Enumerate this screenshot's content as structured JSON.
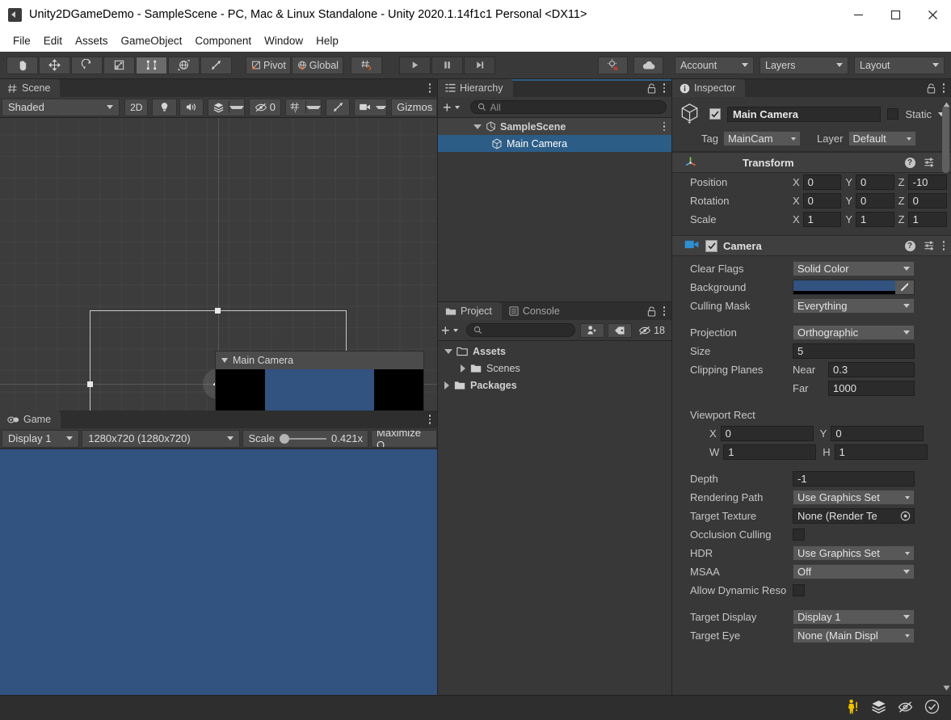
{
  "window": {
    "title": "Unity2DGameDemo - SampleScene - PC, Mac & Linux Standalone - Unity 2020.1.14f1c1 Personal <DX11>",
    "app_icon": "unity-logo-icon",
    "minimize": "minimize-icon",
    "maximize": "maximize-icon",
    "close": "close-icon"
  },
  "menubar": {
    "items": [
      "File",
      "Edit",
      "Assets",
      "GameObject",
      "Component",
      "Window",
      "Help"
    ]
  },
  "toolbar": {
    "tools": [
      {
        "name": "hand-tool",
        "active": false
      },
      {
        "name": "move-tool",
        "active": false
      },
      {
        "name": "rotate-tool",
        "active": false
      },
      {
        "name": "scale-tool",
        "active": false
      },
      {
        "name": "rect-tool",
        "active": true
      },
      {
        "name": "transform-tool",
        "active": false
      },
      {
        "name": "custom-tool",
        "active": false
      }
    ],
    "pivot_label": "Pivot",
    "global_label": "Global",
    "grid_snap": "grid-snapping-icon",
    "play": "play-icon",
    "pause": "pause-icon",
    "step": "step-icon",
    "collab": "collab-icon",
    "cloud": "cloud-icon",
    "account_label": "Account",
    "layers_label": "Layers",
    "layout_label": "Layout"
  },
  "scene_panel": {
    "tab_label": "Scene",
    "tab_icon": "scene-grid-icon",
    "shading_mode": "Shaded",
    "toggle_2d": "2D",
    "lighting_icon": "lightbulb-icon",
    "audio_icon": "audio-icon",
    "effects_icon": "effects-icon",
    "hidden_count": "0",
    "grid_icon": "grid-y-icon",
    "tools_icon": "tools-icon",
    "camera_icon": "camera-icon",
    "gizmos_label": "Gizmos",
    "camera_preview_title": "Main Camera"
  },
  "game_panel": {
    "tab_label": "Game",
    "tab_icon": "gamepad-icon",
    "display": "Display 1",
    "resolution": "1280x720 (1280x720)",
    "scale_label": "Scale",
    "scale_value": "0.421x",
    "maximize_label": "Maximize O",
    "background_color": "#32527f"
  },
  "hierarchy_panel": {
    "tab_label": "Hierarchy",
    "tab_icon": "hierarchy-icon",
    "lock_icon": "lock-icon",
    "menu_icon": "kebab-menu-icon",
    "add_label": "+",
    "search_placeholder": "All",
    "items": [
      {
        "label": "SampleScene",
        "icon": "unity-scene-icon",
        "depth": 0,
        "expanded": true,
        "selected": false
      },
      {
        "label": "Main Camera",
        "icon": "gameobject-cube-icon",
        "depth": 1,
        "expanded": false,
        "selected": true
      }
    ]
  },
  "project_panel": {
    "tabs": [
      {
        "label": "Project",
        "icon": "folder-icon",
        "active": true
      },
      {
        "label": "Console",
        "icon": "console-icon",
        "active": false
      }
    ],
    "search_placeholder": "",
    "hidden_count": "18",
    "tree": [
      {
        "label": "Assets",
        "depth": 0,
        "expanded": true,
        "bold": true
      },
      {
        "label": "Scenes",
        "depth": 1,
        "expanded": false,
        "bold": false
      },
      {
        "label": "Packages",
        "depth": 0,
        "expanded": false,
        "bold": true
      }
    ]
  },
  "inspector": {
    "tab_label": "Inspector",
    "tab_icon": "info-icon",
    "object_name": "Main Camera",
    "object_enabled": true,
    "static_label": "Static",
    "tag_label": "Tag",
    "tag_value": "MainCam",
    "layer_label": "Layer",
    "layer_value": "Default",
    "transform": {
      "title": "Transform",
      "icon": "transform-axis-icon",
      "rows": [
        {
          "label": "Position",
          "x": "0",
          "y": "0",
          "z": "-10"
        },
        {
          "label": "Rotation",
          "x": "0",
          "y": "0",
          "z": "0"
        },
        {
          "label": "Scale",
          "x": "1",
          "y": "1",
          "z": "1"
        }
      ]
    },
    "camera": {
      "title": "Camera",
      "icon": "camera-component-icon",
      "enabled": true,
      "clear_flags_label": "Clear Flags",
      "clear_flags_value": "Solid Color",
      "background_label": "Background",
      "background_color": "#32527f",
      "eyedropper": "eyedropper-icon",
      "culling_mask_label": "Culling Mask",
      "culling_mask_value": "Everything",
      "projection_label": "Projection",
      "projection_value": "Orthographic",
      "size_label": "Size",
      "size_value": "5",
      "clipping_label": "Clipping Planes",
      "near_label": "Near",
      "near_value": "0.3",
      "far_label": "Far",
      "far_value": "1000",
      "viewport_label": "Viewport Rect",
      "viewport_x_label": "X",
      "viewport_x": "0",
      "viewport_y_label": "Y",
      "viewport_y": "0",
      "viewport_w_label": "W",
      "viewport_w": "1",
      "viewport_h_label": "H",
      "viewport_h": "1",
      "depth_label": "Depth",
      "depth_value": "-1",
      "rendering_path_label": "Rendering Path",
      "rendering_path_value": "Use Graphics Set",
      "target_texture_label": "Target Texture",
      "target_texture_value": "None (Render Te",
      "occlusion_label": "Occlusion Culling",
      "occlusion_checked": false,
      "hdr_label": "HDR",
      "hdr_value": "Use Graphics Set",
      "msaa_label": "MSAA",
      "msaa_value": "Off",
      "dynamic_res_label": "Allow Dynamic Reso",
      "dynamic_res_checked": false,
      "target_display_label": "Target Display",
      "target_display_value": "Display 1",
      "target_eye_label": "Target Eye",
      "target_eye_value": "None (Main Displ"
    }
  },
  "statusbar": {
    "icons": [
      "warning-person-icon",
      "layers-stack-icon",
      "visibility-off-icon",
      "check-circle-icon"
    ]
  },
  "colors": {
    "accent_selection": "#2c5d87",
    "panel_bg": "#383838",
    "toolbar_bg": "#393939",
    "field_bg": "#2b2b2b",
    "dropdown_bg": "#585858",
    "game_blue": "#32527f"
  }
}
